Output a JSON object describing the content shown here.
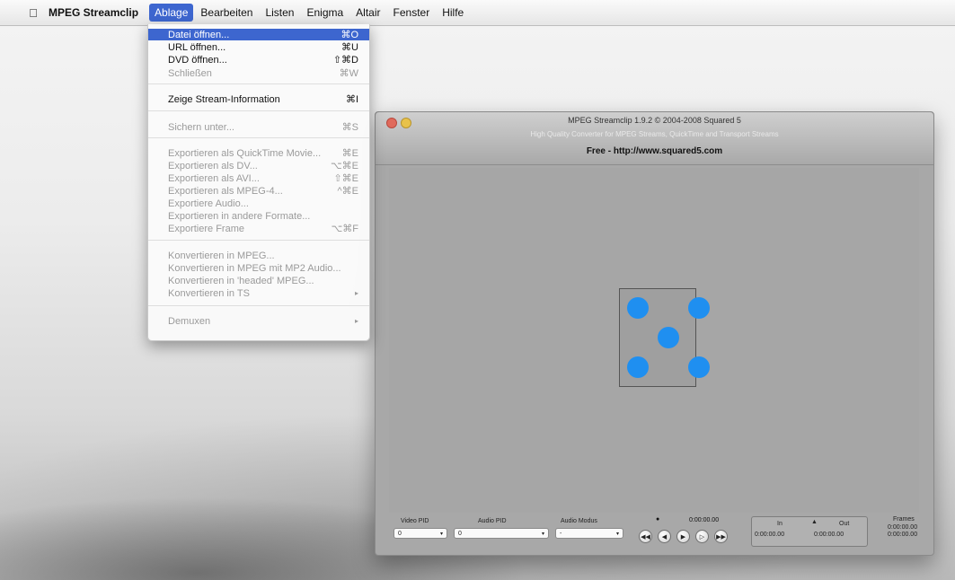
{
  "menubar": {
    "apple_icon": "apple-logo-icon",
    "app_name": "MPEG Streamclip",
    "items": [
      "Ablage",
      "Bearbeiten",
      "Listen",
      "Enigma",
      "Altair",
      "Fenster",
      "Hilfe"
    ],
    "active_item": "Ablage"
  },
  "menu": {
    "items": [
      {
        "label": "Datei öffnen...",
        "shortcut": "⌘O",
        "state": "highlighted"
      },
      {
        "label": "URL öffnen...",
        "shortcut": "⌘U",
        "state": "enabled"
      },
      {
        "label": "DVD öffnen...",
        "shortcut": "⇧⌘D",
        "state": "enabled"
      },
      {
        "label": "Schließen",
        "shortcut": "⌘W",
        "state": "disabled"
      },
      {
        "label": "Zeige Stream-Information",
        "shortcut": "⌘I",
        "state": "enabled"
      },
      {
        "label": "Sichern unter...",
        "shortcut": "⌘S",
        "state": "disabled"
      },
      {
        "label": "Exportieren als QuickTime Movie...",
        "shortcut": "⌘E",
        "state": "disabled"
      },
      {
        "label": "Exportieren als DV...",
        "shortcut": "⌥⌘E",
        "state": "disabled"
      },
      {
        "label": "Exportieren als AVI...",
        "shortcut": "⇧⌘E",
        "state": "disabled"
      },
      {
        "label": "Exportieren als MPEG-4...",
        "shortcut": "^⌘E",
        "state": "disabled"
      },
      {
        "label": "Exportiere Audio...",
        "shortcut": "",
        "state": "disabled"
      },
      {
        "label": "Exportieren in andere Formate...",
        "shortcut": "",
        "state": "disabled"
      },
      {
        "label": "Exportiere Frame",
        "shortcut": "⌥⌘F",
        "state": "disabled"
      },
      {
        "label": "Konvertieren in MPEG...",
        "shortcut": "",
        "state": "disabled"
      },
      {
        "label": "Konvertieren in MPEG mit MP2 Audio...",
        "shortcut": "",
        "state": "disabled"
      },
      {
        "label": "Konvertieren in 'headed' MPEG...",
        "shortcut": "",
        "state": "disabled"
      },
      {
        "label": "Konvertieren in TS",
        "shortcut": "▸",
        "state": "disabled"
      },
      {
        "label": "Demuxen",
        "shortcut": "▸",
        "state": "disabled"
      }
    ]
  },
  "window": {
    "title": "MPEG Streamclip 1.9.2 © 2004-2008 Squared 5",
    "subtitle": "High Quality Converter for MPEG Streams, QuickTime and Transport Streams",
    "url_line": "Free  -  http://www.squared5.com",
    "controls": {
      "video_pid_label": "Video PID",
      "video_pid_value": "0",
      "audio_pid_label": "Audio PID",
      "audio_pid_value": "0",
      "audio_modus_label": "Audio Modus",
      "audio_modus_value": "-",
      "current_time": "0:00:00.00",
      "in_label": "In",
      "out_label": "Out",
      "in_time": "0:00:00.00",
      "out_time": "0:00:00.00",
      "frames_label": "Frames",
      "frames_line1": "0:00:00.00",
      "frames_line2": "0:00:00.00"
    },
    "transport_buttons": [
      "rewind-icon",
      "step-back-icon",
      "play-icon",
      "step-forward-icon",
      "fast-forward-icon"
    ]
  },
  "colors": {
    "accent": "#3d66cf",
    "dots": "#1f8ff0"
  }
}
